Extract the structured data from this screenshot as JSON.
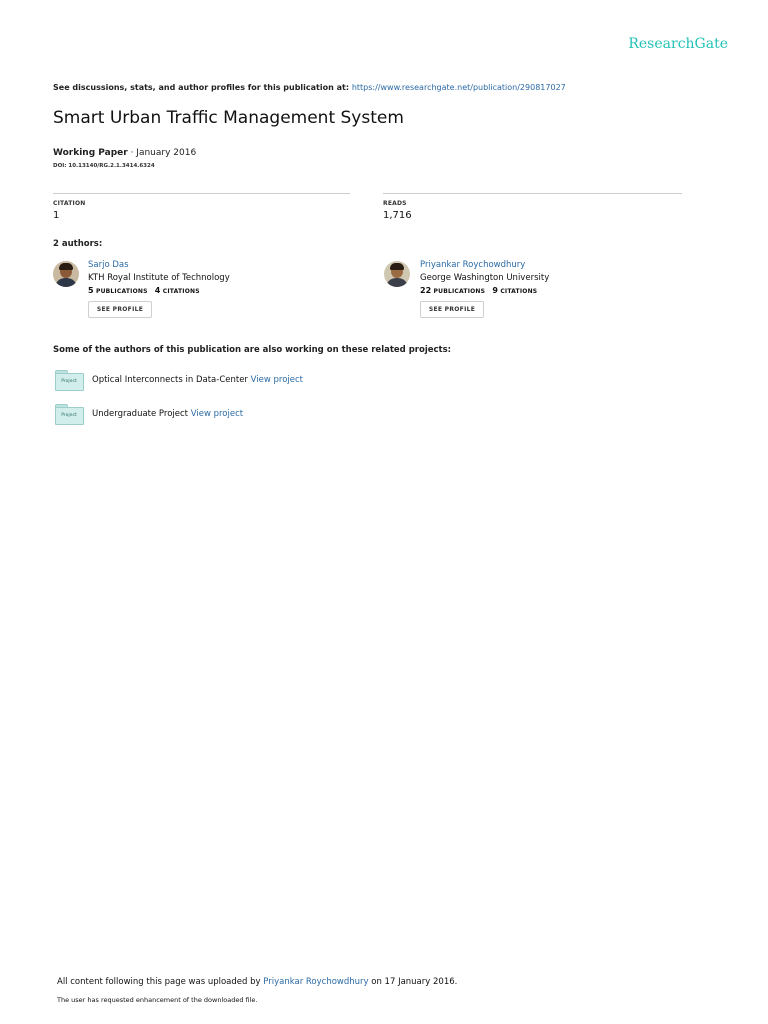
{
  "header": {
    "logo": "ResearchGate",
    "see_discussions": "See discussions, stats, and author profiles for this publication at:",
    "publication_url": "https://www.researchgate.net/publication/290817027"
  },
  "publication": {
    "title": "Smart Urban Traffic Management System",
    "type": "Working Paper",
    "date": " · January 2016",
    "doi": "DOI: 10.13140/RG.2.1.3414.6324"
  },
  "stats": {
    "citation_label": "CITATION",
    "citation_value": "1",
    "reads_label": "READS",
    "reads_value": "1,716"
  },
  "authors_heading": "2 authors:",
  "authors": [
    {
      "name": "Sarjo Das",
      "institution": "KTH Royal Institute of Technology",
      "publications": "5",
      "publications_label": "PUBLICATIONS",
      "citations": "4",
      "citations_label": "CITATIONS",
      "button": "SEE PROFILE"
    },
    {
      "name": "Priyankar Roychowdhury",
      "institution": "George Washington University",
      "publications": "22",
      "publications_label": "PUBLICATIONS",
      "citations": "9",
      "citations_label": "CITATIONS",
      "button": "SEE PROFILE"
    }
  ],
  "related": {
    "heading": "Some of the authors of this publication are also working on these related projects:",
    "folder_label": "Project",
    "projects": [
      {
        "name": "Optical Interconnects in Data-Center ",
        "link": "View project"
      },
      {
        "name": "Undergraduate Project ",
        "link": "View project"
      }
    ]
  },
  "footer": {
    "uploaded_prefix": "All content following this page was uploaded by ",
    "uploader": "Priyankar Roychowdhury",
    "uploaded_suffix": " on 17 January 2016.",
    "note": "The user has requested enhancement of the downloaded file."
  }
}
